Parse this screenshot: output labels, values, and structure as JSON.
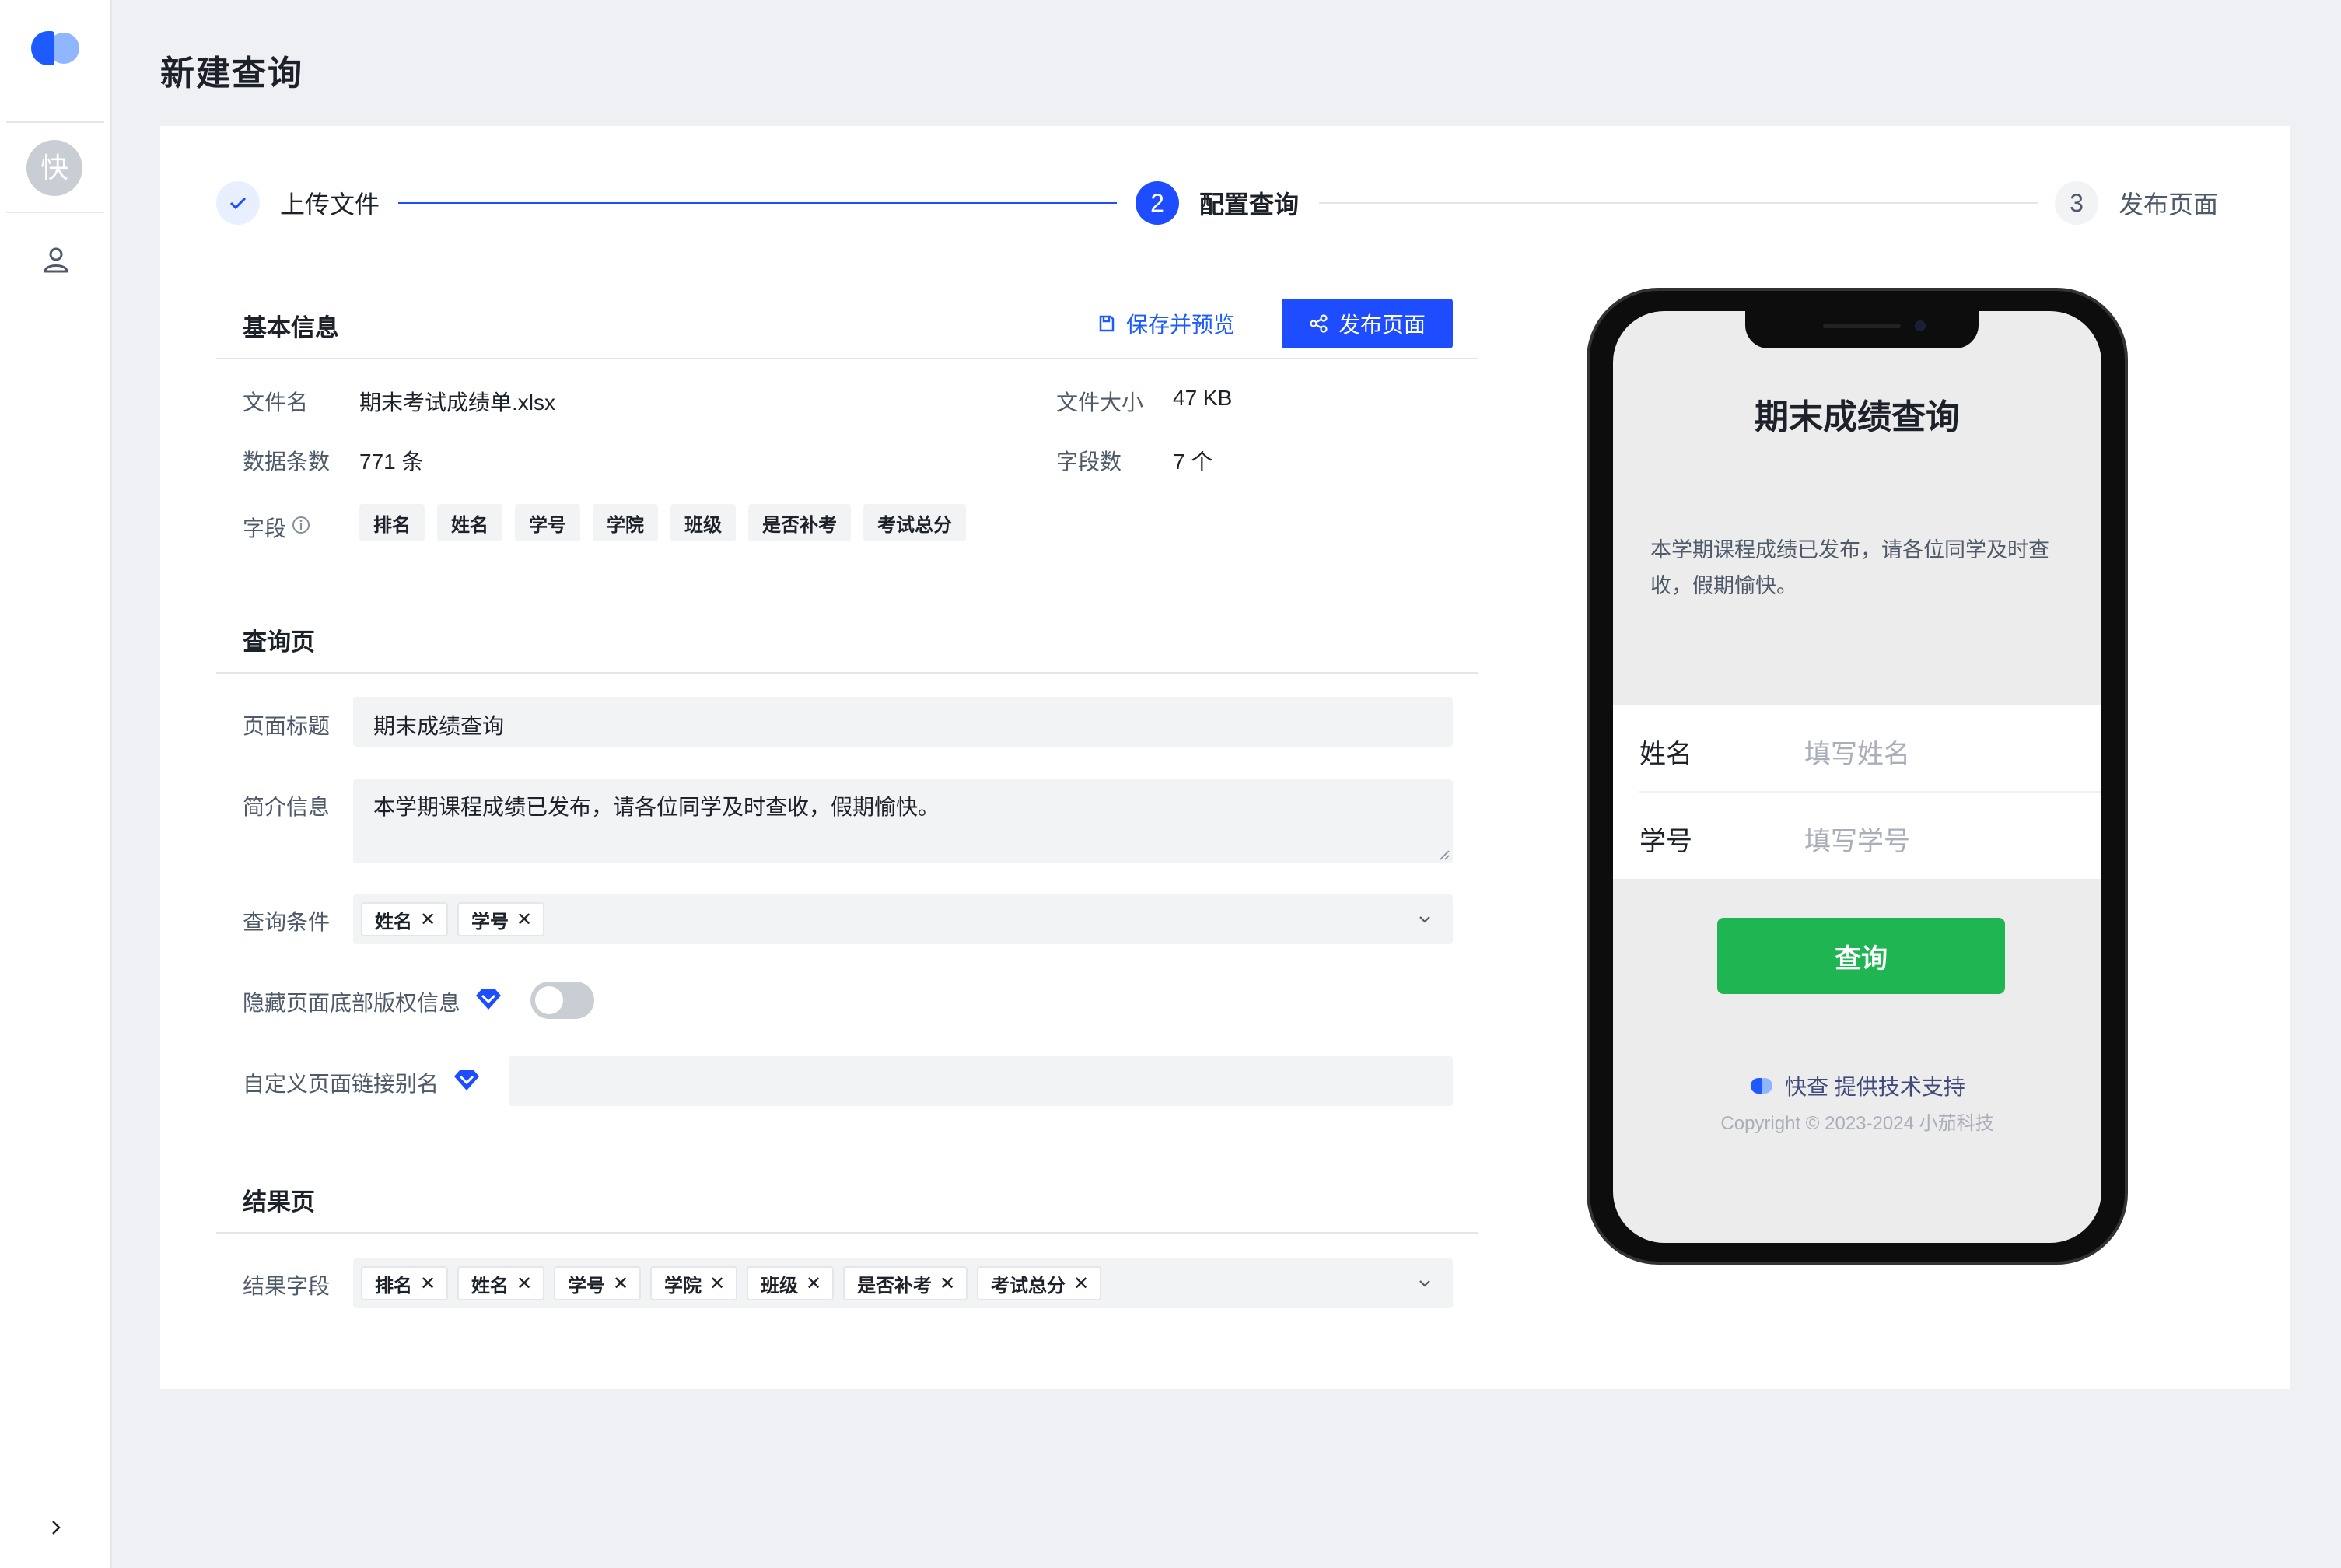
{
  "page": {
    "title": "新建查询"
  },
  "sidebar": {
    "avatar_text": "快"
  },
  "steps": [
    {
      "label": "上传文件",
      "state": "done",
      "number": ""
    },
    {
      "label": "配置查询",
      "state": "active",
      "number": "2"
    },
    {
      "label": "发布页面",
      "state": "pending",
      "number": "3"
    }
  ],
  "basic_info": {
    "title": "基本信息",
    "save_preview_label": "保存并预览",
    "publish_label": "发布页面",
    "file_name_label": "文件名",
    "file_name": "期末考试成绩单.xlsx",
    "file_size_label": "文件大小",
    "file_size": "47 KB",
    "rows_label": "数据条数",
    "rows": "771 条",
    "fields_count_label": "字段数",
    "fields_count": "7 个",
    "fields_label": "字段",
    "fields": [
      "排名",
      "姓名",
      "学号",
      "学院",
      "班级",
      "是否补考",
      "考试总分"
    ]
  },
  "query_page": {
    "title": "查询页",
    "page_title_label": "页面标题",
    "page_title_value": "期末成绩查询",
    "intro_label": "简介信息",
    "intro_value": "本学期课程成绩已发布，请各位同学及时查收，假期愉快。",
    "conditions_label": "查询条件",
    "conditions": [
      "姓名",
      "学号"
    ],
    "hide_copyright_label": "隐藏页面底部版权信息",
    "hide_copyright_enabled": false,
    "alias_label": "自定义页面链接别名",
    "alias_value": ""
  },
  "result_page": {
    "title": "结果页",
    "result_fields_label": "结果字段",
    "result_fields": [
      "排名",
      "姓名",
      "学号",
      "学院",
      "班级",
      "是否补考",
      "考试总分"
    ]
  },
  "preview": {
    "title": "期末成绩查询",
    "description": "本学期课程成绩已发布，请各位同学及时查收，假期愉快。",
    "field_name_label": "姓名",
    "field_name_placeholder": "填写姓名",
    "field_id_label": "学号",
    "field_id_placeholder": "填写学号",
    "query_button": "查询",
    "support_text": "快查 提供技术支持",
    "copyright": "Copyright © 2023-2024 小茄科技"
  },
  "colors": {
    "primary": "#1d4dff",
    "query_green": "#1fb553",
    "page_bg": "#eff0f4"
  }
}
